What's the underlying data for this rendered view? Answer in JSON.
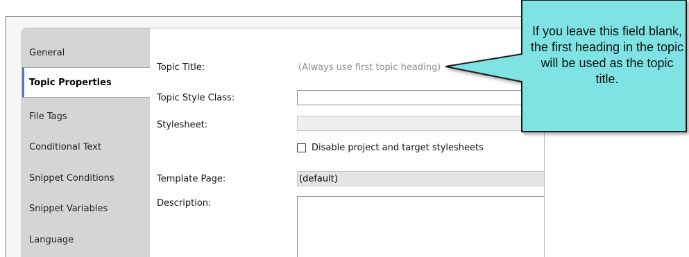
{
  "sidebar": {
    "items": [
      {
        "label": "General",
        "active": false
      },
      {
        "label": "Topic Properties",
        "active": true
      },
      {
        "label": "File Tags",
        "active": false
      },
      {
        "label": "Conditional Text",
        "active": false
      },
      {
        "label": "Snippet Conditions",
        "active": false
      },
      {
        "label": "Snippet Variables",
        "active": false
      },
      {
        "label": "Language",
        "active": false
      }
    ]
  },
  "form": {
    "topic_title_label": "Topic Title:",
    "topic_title_placeholder": "(Always use first topic heading)",
    "topic_style_class_label": "Topic Style Class:",
    "topic_style_class_value": "",
    "stylesheet_label": "Stylesheet:",
    "stylesheet_value": "",
    "disable_stylesheets_label": "Disable project and target stylesheets",
    "disable_stylesheets_checked": false,
    "template_page_label": "Template Page:",
    "template_page_value": "(default)",
    "description_label": "Description:",
    "description_value": ""
  },
  "callout": {
    "text": "If you leave this field blank, the first heading in the topic will be used as the topic title.",
    "fill_color": "#7fe3e3",
    "border_color": "#1f1f1f"
  }
}
